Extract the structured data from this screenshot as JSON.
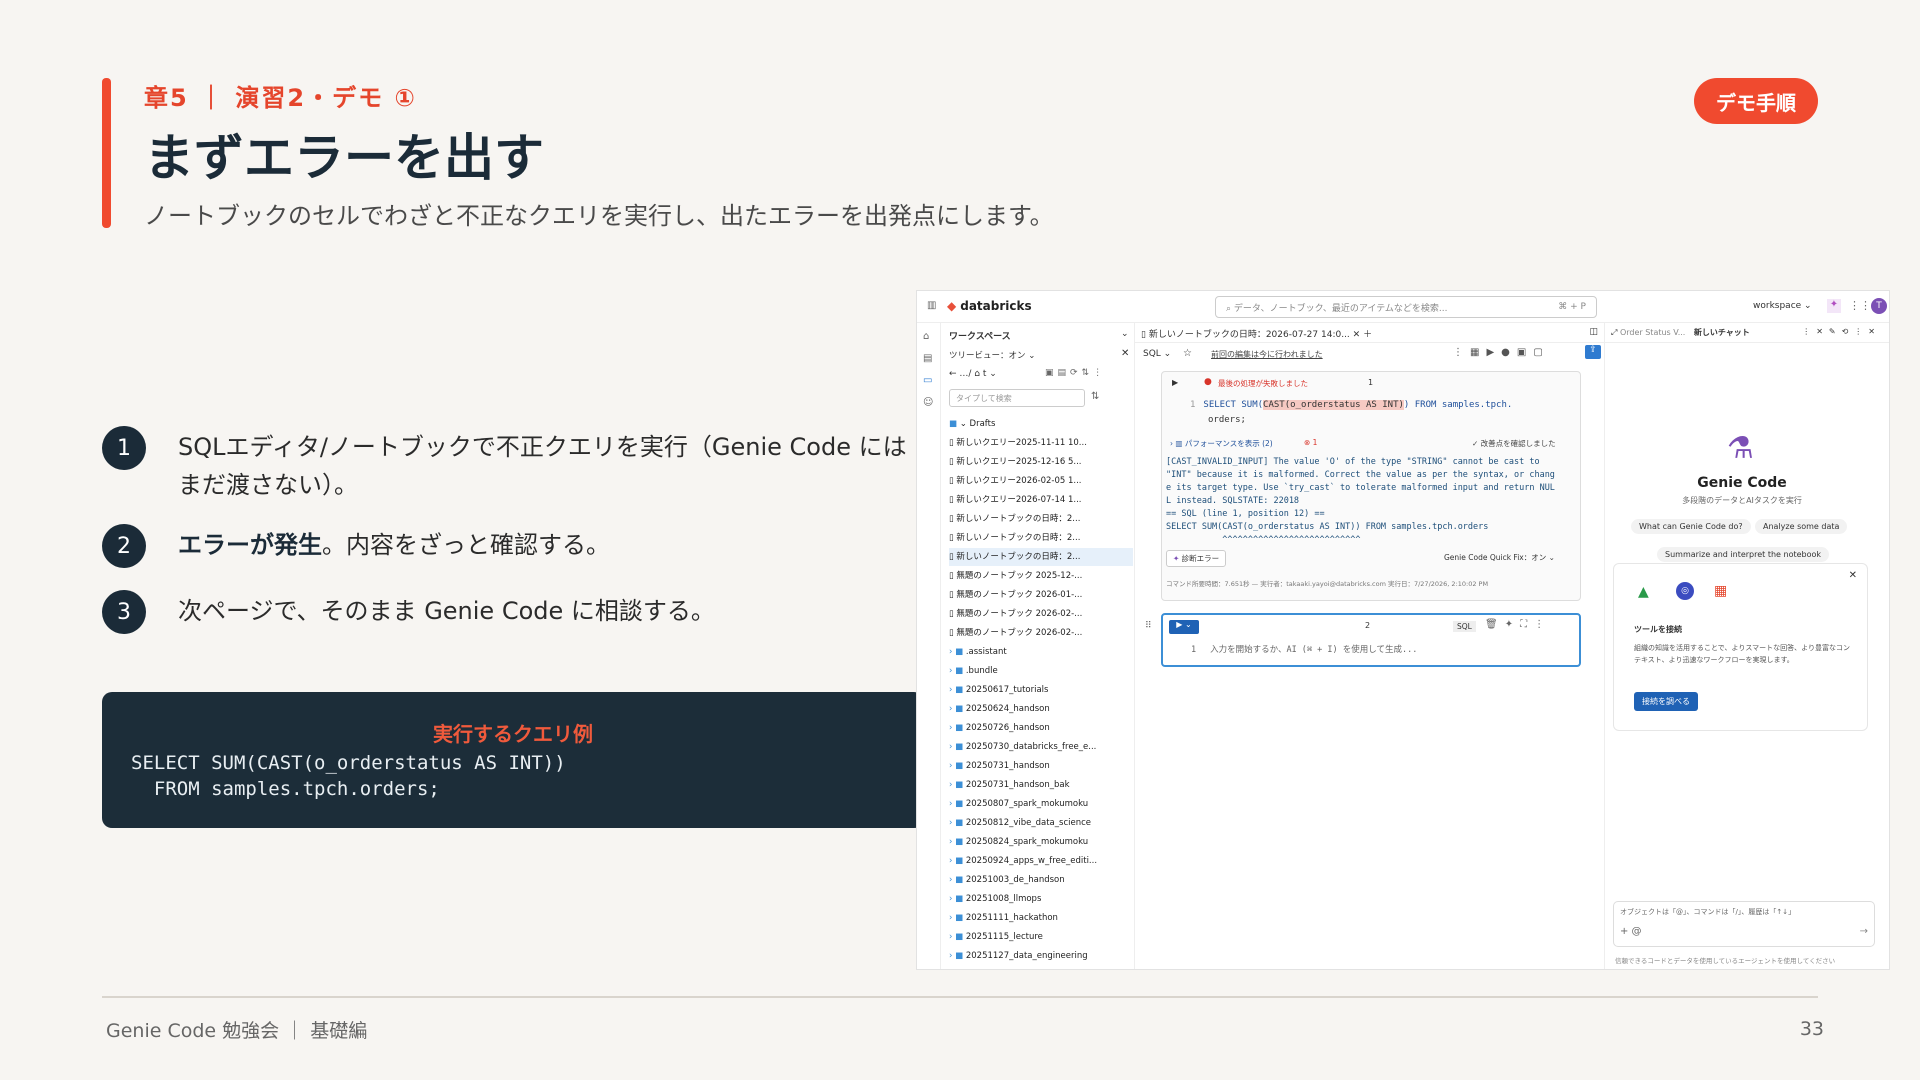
{
  "header": {
    "chapter": "章5 ｜ 演習2・デモ ①",
    "title": "まずエラーを出す",
    "subtitle": "ノートブックのセルでわざと不正なクエリを実行し、出たエラーを出発点にします。",
    "badge": "デモ手順"
  },
  "steps": [
    {
      "num": "1",
      "text": "SQLエディタ/ノートブックで不正クエリを実行（Genie Code にはまだ渡さない）。"
    },
    {
      "num": "2",
      "bold": "エラーが発生",
      "text": "。内容をざっと確認する。"
    },
    {
      "num": "3",
      "text": "次ページで、そのまま Genie Code に相談する。"
    }
  ],
  "query_example": {
    "title": "実行するクエリ例",
    "code": "SELECT SUM(CAST(o_orderstatus AS INT))\n  FROM samples.tpch.orders;"
  },
  "footer": {
    "left": "Genie Code 勉強会 ｜ 基礎編",
    "page": "33"
  },
  "screenshot": {
    "logo": "databricks",
    "search_placeholder": "データ、ノートブック、最近のアイテムなどを検索...",
    "search_kbd": "⌘ + P",
    "workspace": "workspace ⌄",
    "avatar": "T",
    "ws_title": "ワークスペース",
    "tree_view": "ツリービュー：オン ⌄",
    "path": "← …/ ⌂ t ⌄",
    "filter_placeholder": "タイプして検索",
    "tree": [
      {
        "label": "⌄ Drafts",
        "type": "folder"
      },
      {
        "label": "新しいクエリー2025-11-11 10...",
        "type": "file"
      },
      {
        "label": "新しいクエリー2025-12-16 5...",
        "type": "file"
      },
      {
        "label": "新しいクエリー2026-02-05 1...",
        "type": "file"
      },
      {
        "label": "新しいクエリー2026-07-14 1...",
        "type": "file"
      },
      {
        "label": "新しいノートブックの日時：2...",
        "type": "file"
      },
      {
        "label": "新しいノートブックの日時：2...",
        "type": "file"
      },
      {
        "label": "新しいノートブックの日時：2...",
        "type": "sel"
      },
      {
        "label": "無題のノートブック 2025-12-...",
        "type": "file"
      },
      {
        "label": "無題のノートブック 2026-01-...",
        "type": "file"
      },
      {
        "label": "無題のノートブック 2026-02-...",
        "type": "file"
      },
      {
        "label": "無題のノートブック 2026-02-...",
        "type": "file"
      },
      {
        "label": ".assistant",
        "type": "folder"
      },
      {
        "label": ".bundle",
        "type": "folder"
      },
      {
        "label": "20250617_tutorials",
        "type": "folder"
      },
      {
        "label": "20250624_handson",
        "type": "folder"
      },
      {
        "label": "20250726_handson",
        "type": "folder"
      },
      {
        "label": "20250730_databricks_free_e...",
        "type": "folder"
      },
      {
        "label": "20250731_handson",
        "type": "folder"
      },
      {
        "label": "20250731_handson_bak",
        "type": "folder"
      },
      {
        "label": "20250807_spark_mokumoku",
        "type": "folder"
      },
      {
        "label": "20250812_vibe_data_science",
        "type": "folder"
      },
      {
        "label": "20250824_spark_mokumoku",
        "type": "folder"
      },
      {
        "label": "20250924_apps_w_free_editi...",
        "type": "folder"
      },
      {
        "label": "20251003_de_handson",
        "type": "folder"
      },
      {
        "label": "20251008_llmops",
        "type": "folder"
      },
      {
        "label": "20251111_hackathon",
        "type": "folder"
      },
      {
        "label": "20251115_lecture",
        "type": "folder"
      },
      {
        "label": "20251127_data_engineering",
        "type": "folder"
      }
    ],
    "tab_title": "新しいノートブックの日時：2026-07-27 14:0...",
    "lang": "SQL ⌄",
    "last_edit": "前回の編集は今に行われました",
    "cell1": {
      "status": "最後の処理が失敗しました",
      "num": "1",
      "line_no": "1",
      "code_a": "SELECT SUM(",
      "code_hl": "CAST(o_orderstatus AS INT)",
      "code_b": ") FROM samples.tpch.",
      "code_c": "orders;",
      "perf": "パフォーマンスを表示 (2)",
      "err_count": "⊗ 1",
      "fix_note": "✓ 改善点を確認しました",
      "error": "[CAST_INVALID_INPUT] The value 'O' of the type \"STRING\" cannot be cast to\n\"INT\" because it is malformed. Correct the value as per the syntax, or chang\ne its target type. Use `try_cast` to tolerate malformed input and return NUL\nL instead. SQLSTATE: 22018\n== SQL (line 1, position 12) ==\nSELECT SUM(CAST(o_orderstatus AS INT)) FROM samples.tpch.orders\n           ^^^^^^^^^^^^^^^^^^^^^^^^^^^",
      "diag_button": "診断エラー",
      "quickfix": "Genie Code Quick Fix：オン ⌄",
      "meta": "コマンド所要時間：7.651秒 — 実行者：takaaki.yayoi@databricks.com 実行日：7/27/2026, 2:10:02 PM"
    },
    "cell2": {
      "num": "2",
      "lang": "SQL",
      "line_no": "1",
      "placeholder": "入力を開始するか、AI (⌘ + I) を使用して生成..."
    },
    "genie": {
      "tab1": "Order Status V...",
      "tab2": "新しいチャット",
      "name": "Genie Code",
      "desc": "多段階のデータとAIタスクを実行",
      "chips": [
        "What can Genie Code do?",
        "Analyze some data",
        "Summarize and interpret the notebook"
      ],
      "connect_title": "ツールを接続",
      "connect_desc": "組織の知識を活用することで、よりスマートな回答、より豊富なコンテキスト、より迅速なワークフローを実現します。",
      "connect_button": "接続を調べる",
      "input_hint": "オブジェクトは「@」、コマンドは「/」、履歴は「↑↓」",
      "input_prefix": "+  @",
      "disclaimer": "信頼できるコードとデータを使用しているエージェントを使用してください"
    }
  },
  "colors": {
    "accent": "#f04a2f",
    "navy": "#1b2b38",
    "genie_purple": "#7b4fb5"
  }
}
